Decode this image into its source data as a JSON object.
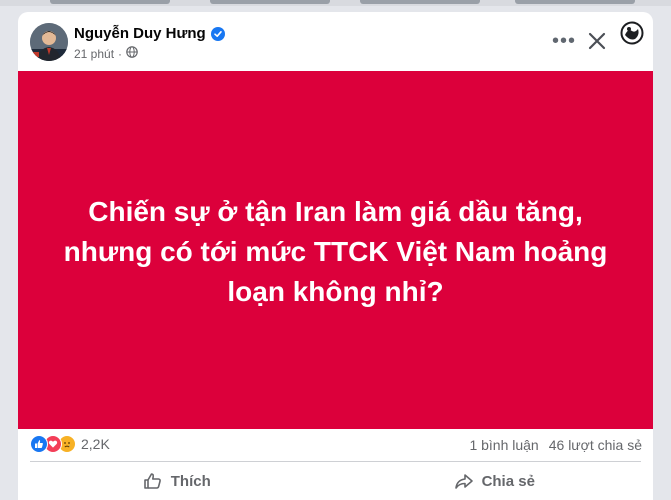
{
  "post": {
    "author": "Nguyễn Duy Hưng",
    "time": "21 phút",
    "separator": "·",
    "text": "Chiến sự ở tận Iran làm giá dầu tăng, nhưng có tới mức TTCK Việt Nam hoảng loạn không nhỉ?",
    "background_color": "#dc003b"
  },
  "reactions": {
    "types": [
      "like-icon",
      "love-icon",
      "sad-icon"
    ],
    "count": "2,2K"
  },
  "stats": {
    "comments": "1 bình luận",
    "shares": "46 lượt chia sẻ"
  },
  "actions": {
    "like_label": "Thích",
    "share_label": "Chia sẻ"
  },
  "colors": {
    "accent": "#1877f2",
    "text_secondary": "#65676b"
  }
}
